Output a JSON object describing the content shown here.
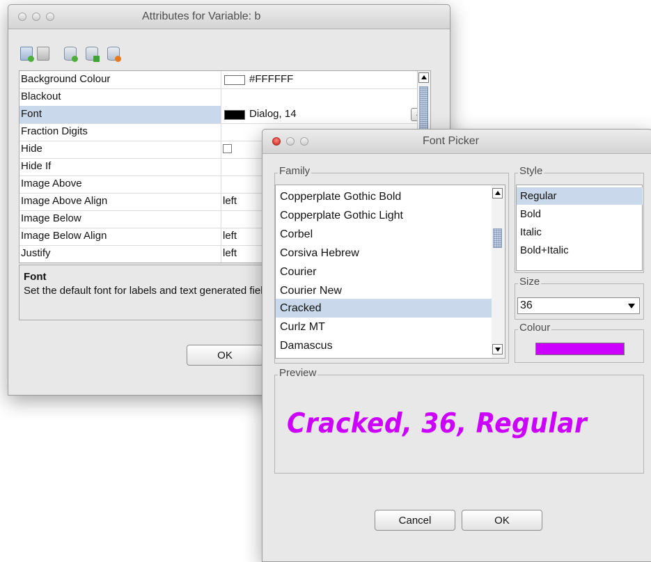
{
  "attributes_window": {
    "title": "Attributes for Variable: b",
    "toolbar": {
      "icons": [
        "add-table-icon",
        "remove-table-icon",
        "add-db-icon",
        "export-db-icon",
        "delete-db-icon"
      ]
    },
    "rows": [
      {
        "name": "Background Colour",
        "value": "#FFFFFF",
        "swatch": "#FFFFFF"
      },
      {
        "name": "Blackout",
        "value": ""
      },
      {
        "name": "Font",
        "value": "Dialog, 14",
        "swatch": "#000000",
        "button": "..."
      },
      {
        "name": "Fraction Digits",
        "value": ""
      },
      {
        "name": "Hide",
        "value": ""
      },
      {
        "name": "Hide If",
        "value": ""
      },
      {
        "name": "Image Above",
        "value": ""
      },
      {
        "name": "Image Above Align",
        "value": "left"
      },
      {
        "name": "Image Below",
        "value": ""
      },
      {
        "name": "Image Below Align",
        "value": "left"
      },
      {
        "name": "Justify",
        "value": "left"
      }
    ],
    "description": {
      "title": "Font",
      "text": "Set the default font for labels and text generated field"
    },
    "ok_label": "OK"
  },
  "font_picker": {
    "title": "Font Picker",
    "family_label": "Family",
    "families": [
      "Copperplate Gothic Bold",
      "Copperplate Gothic Light",
      "Corbel",
      "Corsiva Hebrew",
      "Courier",
      "Courier New",
      "Cracked",
      "Curlz MT",
      "Damascus"
    ],
    "selected_family": "Cracked",
    "style_label": "Style",
    "styles": [
      "Regular",
      "Bold",
      "Italic",
      "Bold+Italic"
    ],
    "selected_style": "Regular",
    "size_label": "Size",
    "size_value": "36",
    "colour_label": "Colour",
    "colour": "#CC00FF",
    "preview_label": "Preview",
    "preview_text": "Cracked, 36, Regular",
    "cancel_label": "Cancel",
    "ok_label": "OK"
  },
  "colors": {
    "selection": "#C9D8EA",
    "accent_purple": "#CC00FF"
  }
}
